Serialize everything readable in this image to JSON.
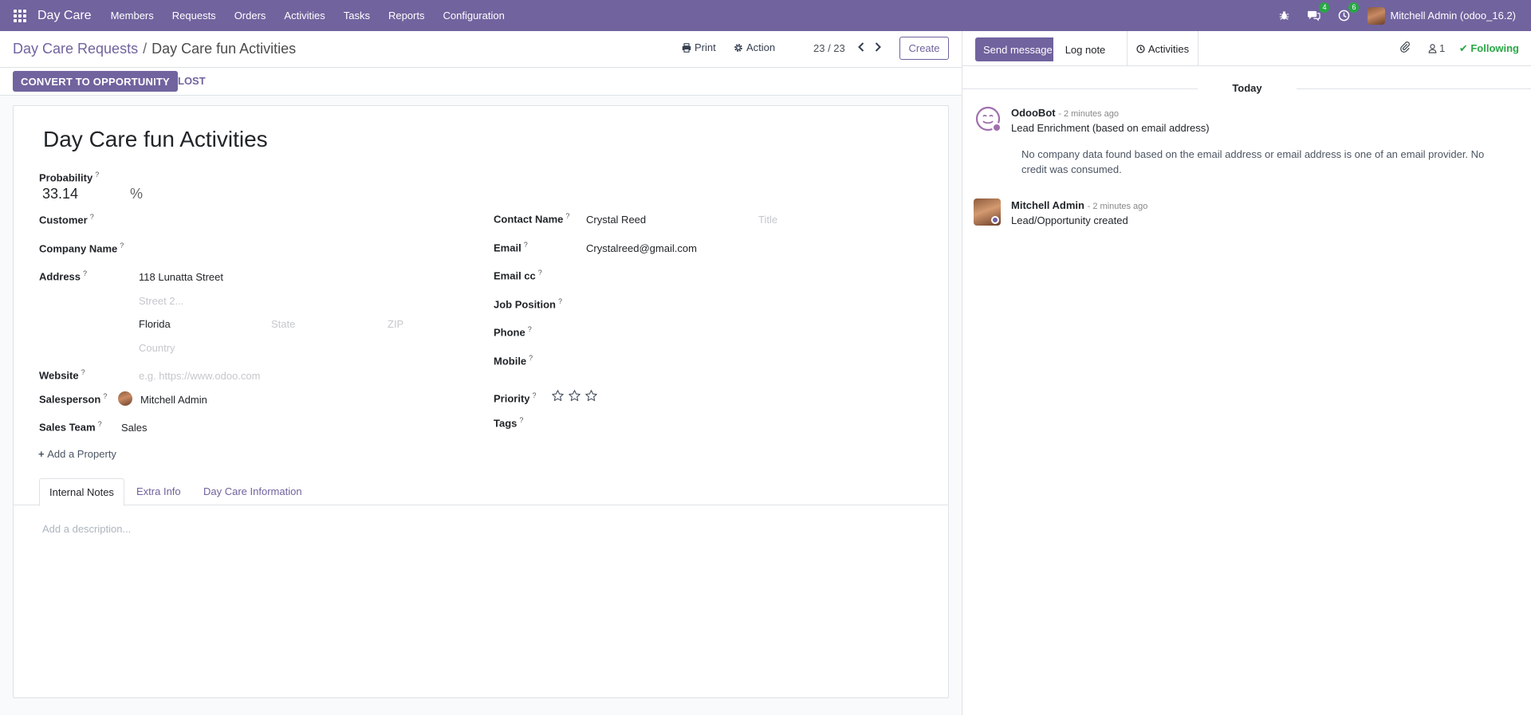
{
  "navbar": {
    "brand": "Day Care",
    "menu": [
      "Members",
      "Requests",
      "Orders",
      "Activities",
      "Tasks",
      "Reports",
      "Configuration"
    ],
    "messages_count": "4",
    "activities_count": "6",
    "user": "Mitchell Admin (odoo_16.2)"
  },
  "control_panel": {
    "breadcrumb_parent": "Day Care Requests",
    "breadcrumb_sep": "/",
    "breadcrumb_current": "Day Care fun Activities",
    "print_label": "Print",
    "action_label": "Action",
    "pager": "23 / 23",
    "create_label": "Create"
  },
  "status_bar": {
    "convert_label": "CONVERT TO OPPORTUNITY",
    "lost_label": "LOST"
  },
  "form": {
    "title": "Day Care fun Activities",
    "probability_label": "Probability",
    "probability_value": "33.14",
    "probability_unit": "%",
    "customer_label": "Customer",
    "company_label": "Company Name",
    "address_label": "Address",
    "street": "118 Lunatta Street",
    "street2_placeholder": "Street 2...",
    "city": "Florida",
    "state_placeholder": "State",
    "zip_placeholder": "ZIP",
    "country_placeholder": "Country",
    "website_label": "Website",
    "website_placeholder": "e.g. https://www.odoo.com",
    "salesperson_label": "Salesperson",
    "salesperson_value": "Mitchell Admin",
    "sales_team_label": "Sales Team",
    "sales_team_value": "Sales",
    "contact_label": "Contact Name",
    "contact_value": "Crystal Reed",
    "title_placeholder": "Title",
    "email_label": "Email",
    "email_value": "Crystalreed@gmail.com",
    "email_cc_label": "Email cc",
    "job_label": "Job Position",
    "phone_label": "Phone",
    "mobile_label": "Mobile",
    "priority_label": "Priority",
    "priority_value": 0,
    "tags_label": "Tags",
    "help_mark": "?",
    "add_property": "Add a Property",
    "tabs": [
      "Internal Notes",
      "Extra Info",
      "Day Care Information"
    ],
    "description_placeholder": "Add a description..."
  },
  "chatter": {
    "send_message": "Send message",
    "log_note": "Log note",
    "activities": "Activities",
    "followers_count": "1",
    "following": "Following",
    "date_separator": "Today",
    "messages": [
      {
        "author": "OdooBot",
        "time": "- 2 minutes ago",
        "text": "Lead Enrichment (based on email address)",
        "body": "No company data found based on the email address or email address is one of an email provider. No credit was consumed."
      },
      {
        "author": "Mitchell Admin",
        "time": "- 2 minutes ago",
        "text": "Lead/Opportunity created"
      }
    ]
  },
  "colors": {
    "brand": "#71639e",
    "following": "#28a745",
    "badge": "#28a745"
  }
}
